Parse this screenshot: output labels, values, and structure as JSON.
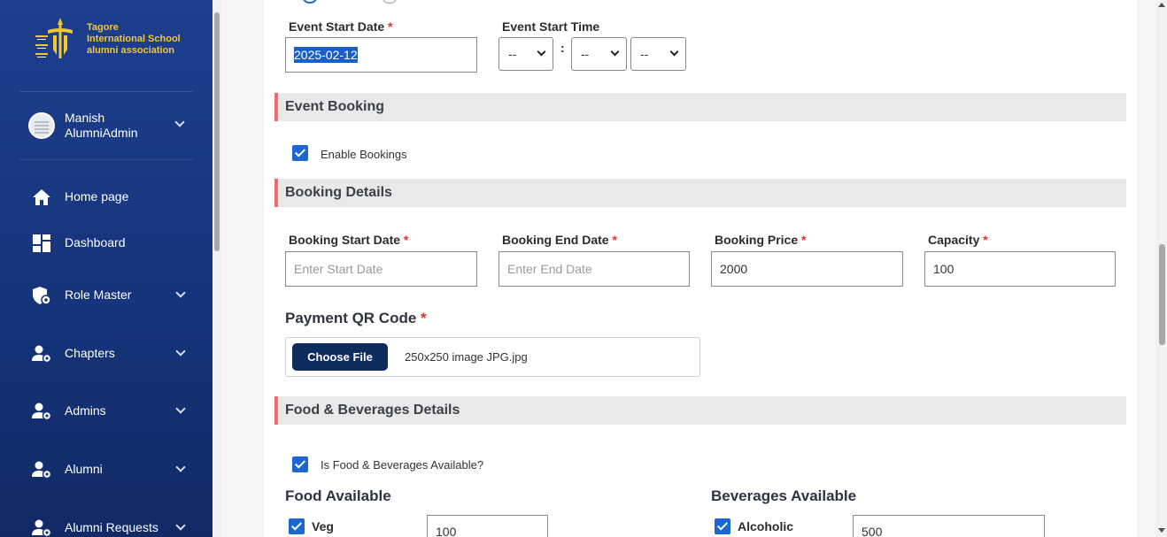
{
  "sidebar": {
    "logo": {
      "line1": "Tagore",
      "line2": "International School",
      "line3": "alumni association"
    },
    "user": {
      "first_name": "Manish",
      "last_name": "AlumniAdmin"
    },
    "items": [
      {
        "label": "Home page",
        "icon": "home-icon"
      },
      {
        "label": "Dashboard",
        "icon": "dashboard-icon"
      },
      {
        "label": "Role Master",
        "icon": "shield-gear-icon"
      },
      {
        "label": "Chapters",
        "icon": "user-gear-icon"
      },
      {
        "label": "Admins",
        "icon": "user-gear-icon"
      },
      {
        "label": "Alumni",
        "icon": "user-gear-icon"
      },
      {
        "label": "Alumni Requests",
        "icon": "user-gear-icon"
      }
    ]
  },
  "event": {
    "start_date_label": "Event Start Date",
    "start_date_value": "2025-02-12",
    "start_time_label": "Event Start Time",
    "time_selects": [
      "--",
      "--",
      "--"
    ],
    "time_separator": ":"
  },
  "booking": {
    "section_title": "Event Booking",
    "enable_label": "Enable Bookings"
  },
  "booking_details": {
    "section_title": "Booking Details",
    "start_label": "Booking Start Date",
    "start_placeholder": "Enter Start Date",
    "end_label": "Booking End Date",
    "end_placeholder": "Enter End Date",
    "price_label": "Booking Price",
    "price_value": "2000",
    "capacity_label": "Capacity",
    "capacity_value": "100",
    "qr_label": "Payment QR Code",
    "choose_file": "Choose File",
    "file_name": "250x250 image JPG.jpg"
  },
  "food": {
    "section_title": "Food & Beverages Details",
    "available_label": "Is Food & Beverages Available?",
    "food_heading": "Food Available",
    "veg_label": "Veg",
    "veg_value": "100",
    "bev_heading": "Beverages Available",
    "alcoholic_label": "Alcoholic",
    "alcoholic_value": "500"
  },
  "required_mark": "*",
  "colors": {
    "sidebar_bg": "#1a3a85",
    "logo_gold": "#f3c633",
    "accent_blue": "#1c67d1",
    "section_bar": "#ec6b6b",
    "file_button": "#0f2d5c",
    "required": "#e03131"
  }
}
